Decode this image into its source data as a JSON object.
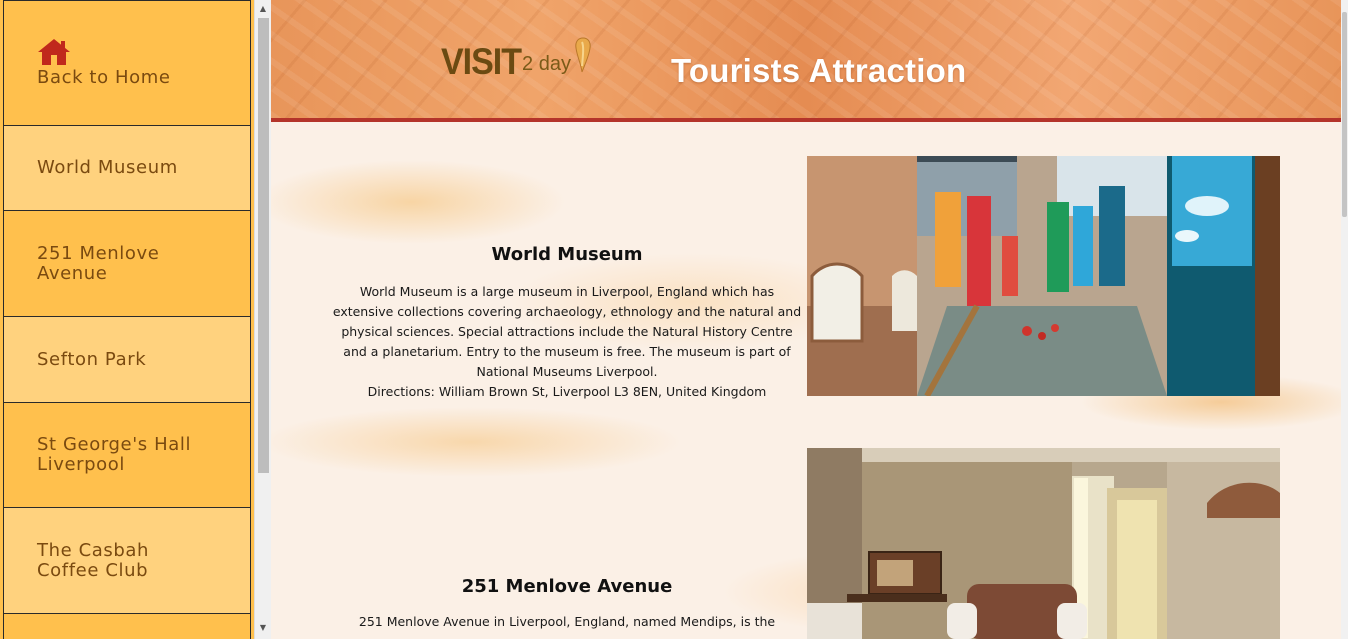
{
  "sidebar": {
    "items": [
      {
        "label": "Back to Home",
        "icon": "home-icon"
      },
      {
        "label": "World Museum"
      },
      {
        "label": "251 Menlove Avenue"
      },
      {
        "label": "Sefton Park"
      },
      {
        "label": "St George's Hall Liverpool"
      },
      {
        "label": "The Casbah Coffee Club"
      }
    ]
  },
  "header": {
    "logo_main": "VISIT",
    "logo_sub": "2 day",
    "title": "Tourists Attraction"
  },
  "attractions": [
    {
      "title": "World Museum",
      "description": "World Museum is a large museum in Liverpool, England which has extensive collections covering archaeology, ethnology and the natural and physical sciences. Special attractions include the Natural History Centre and a planetarium. Entry to the museum is free. The museum is part of National Museums Liverpool.",
      "directions": "Directions: William Brown St, Liverpool L3 8EN, United Kingdom"
    },
    {
      "title": "251 Menlove Avenue",
      "description": "251 Menlove Avenue in Liverpool, England, named Mendips, is the"
    }
  ],
  "colors": {
    "sidebar_main": "#ffc04d",
    "sidebar_alt": "#ffd27e",
    "sidebar_text": "#7a4a10",
    "header_accent": "#b4342a",
    "home_icon": "#c0281c"
  }
}
